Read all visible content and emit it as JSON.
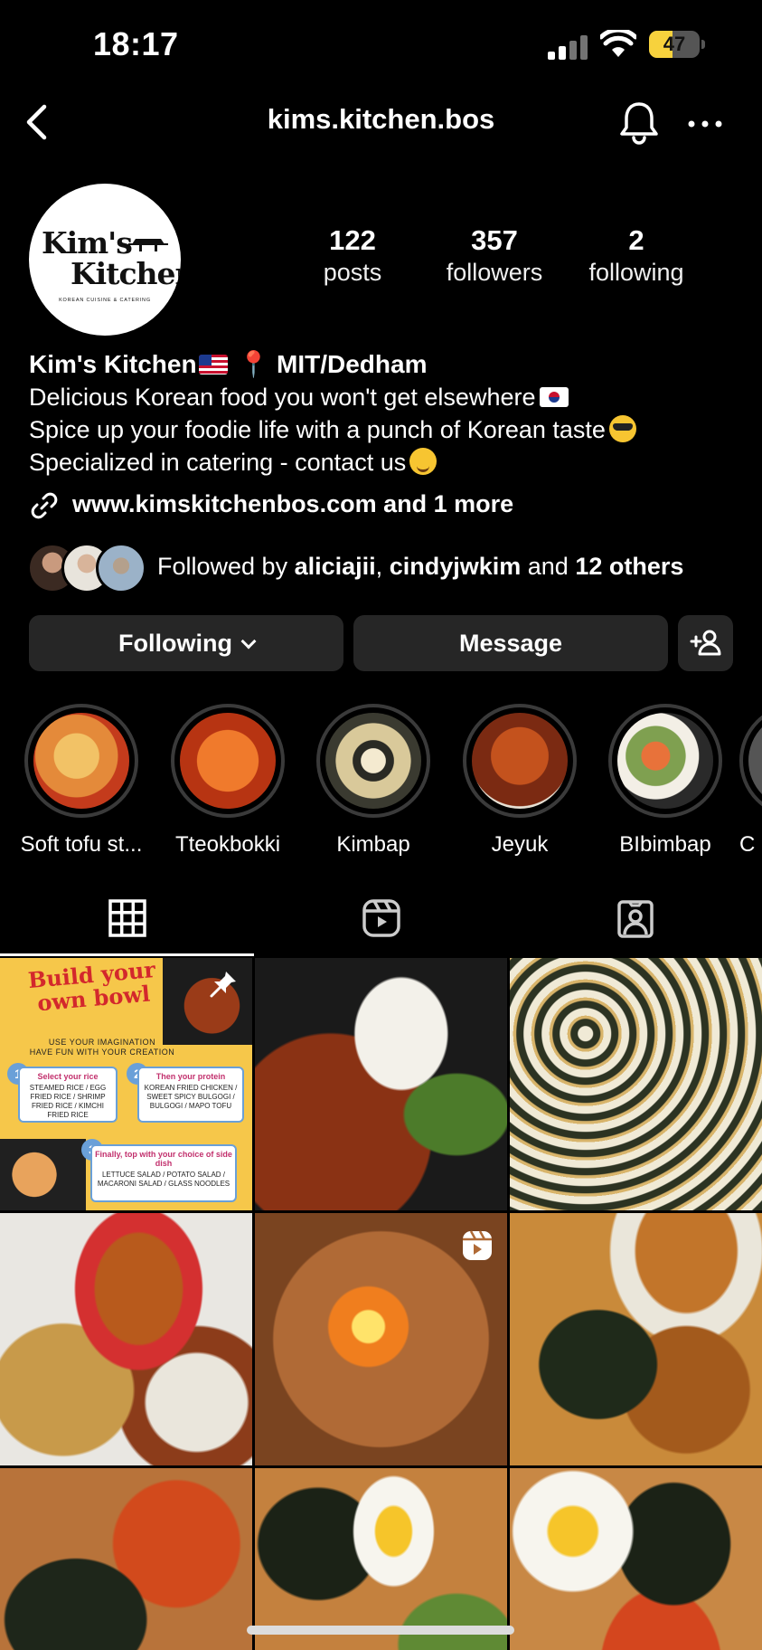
{
  "status_bar": {
    "time": "18:17",
    "battery": "47",
    "battery_level": 0.47
  },
  "header": {
    "username": "kims.kitchen.bos",
    "icons": [
      "back-chevron-icon",
      "bell-icon",
      "more-icon"
    ]
  },
  "profile": {
    "avatar_logo": {
      "line1": "Kim's",
      "line2": "Kitchen",
      "tagline": "KOREAN CUISINE & CATERING"
    },
    "stats": [
      {
        "value": "122",
        "label": "posts"
      },
      {
        "value": "357",
        "label": "followers"
      },
      {
        "value": "2",
        "label": "following"
      }
    ],
    "bio": {
      "name": "Kim's Kitchen",
      "location": "MIT/Dedham",
      "lines": [
        "Delicious Korean food you won't get elsewhere",
        "Spice up your foodie life with a punch of Korean taste",
        "Specialized in catering - contact us"
      ]
    },
    "link": "www.kimskitchenbos.com and 1 more",
    "followed_by": {
      "prefix": "Followed by",
      "user1": "aliciajii",
      "separator": ",",
      "user2": "cindyjwkim",
      "conjunction": "and",
      "others": "12 others"
    }
  },
  "buttons": {
    "following": "Following",
    "message": "Message"
  },
  "highlights": [
    {
      "label": "Soft tofu st...",
      "color": "#e8a34a"
    },
    {
      "label": "Tteokbokki",
      "color": "#d9541f"
    },
    {
      "label": "Kimbap",
      "color": "#c9b58c"
    },
    {
      "label": "Jeyuk",
      "color": "#b84a23"
    },
    {
      "label": "BIbimbap",
      "color": "#6d8a4b"
    },
    {
      "label": "C",
      "color": "#888888"
    }
  ],
  "tabs": [
    "grid-tab",
    "reels-tab",
    "tagged-tab"
  ],
  "grid_posts": {
    "post1": {
      "title_line1": "Build your",
      "title_line2": "own bowl",
      "subtitle_line1": "USE YOUR IMAGINATION",
      "subtitle_line2": "HAVE FUN WITH YOUR CREATION",
      "step1_title": "Select your rice",
      "step1_items": "STEAMED RICE / EGG FRIED RICE / SHRIMP FRIED RICE / KIMCHI FRIED RICE",
      "step2_title": "Then your protein",
      "step2_items": "KOREAN FRIED CHICKEN / SWEET SPICY BULGOGI / BULGOGI / MAPO TOFU",
      "step3_title": "Finally, top with your choice of side dish",
      "step3_items": "LETTUCE SALAD / POTATO SALAD / MACARONI SALAD / GLASS NOODLES",
      "num1": "1",
      "num2": "2",
      "num3": "3"
    }
  }
}
